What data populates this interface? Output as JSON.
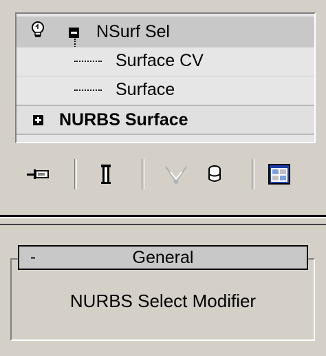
{
  "modifier_stack": {
    "selected_item": {
      "label": "NSurf Sel",
      "expander": "minus-box-icon",
      "visibility_icon": "lightbulb-icon",
      "sub_objects": [
        {
          "label": "Surface CV"
        },
        {
          "label": "Surface"
        }
      ]
    },
    "base_object": {
      "label": "NURBS Surface",
      "expander": "plus-box-icon"
    }
  },
  "toolbar": {
    "buttons": [
      {
        "name": "pin-stack-icon",
        "enabled": true
      },
      {
        "name": "show-end-result-icon",
        "enabled": true
      },
      {
        "name": "make-unique-icon",
        "enabled": false
      },
      {
        "name": "remove-modifier-icon",
        "enabled": true
      },
      {
        "name": "configure-modifier-sets-icon",
        "enabled": true
      }
    ]
  },
  "rollout": {
    "toggle": "-",
    "title": "General",
    "body_text": "NURBS Select Modifier"
  },
  "colors": {
    "panel_bg": "#d4d0c8",
    "selected_row": "#c8c8c8",
    "list_bg": "#e6e6e6",
    "configure_icon_blue": "#1c3fa8"
  }
}
